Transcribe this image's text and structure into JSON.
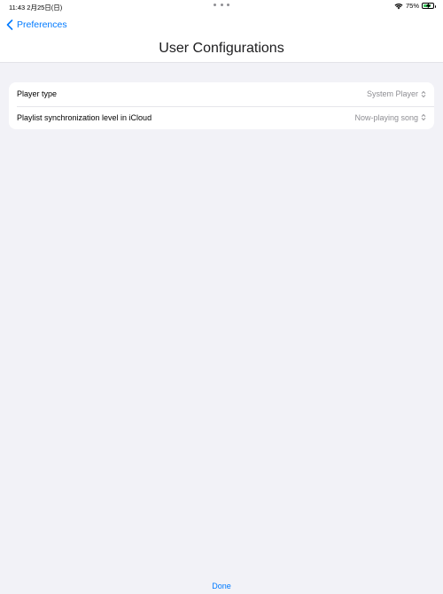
{
  "status_bar": {
    "time_date": "11:43  2月25日(日)",
    "battery_percent": "75%",
    "battery_level": 0.75,
    "wifi_icon": "wifi-icon",
    "battery_icon": "battery-charging-icon"
  },
  "nav": {
    "back_label": "Preferences",
    "back_icon": "chevron-left-icon",
    "title": "User Configurations"
  },
  "settings": {
    "rows": [
      {
        "label": "Player type",
        "value": "System Player",
        "icon": "chevron-up-down-icon"
      },
      {
        "label": "Playlist synchronization level in iCloud",
        "value": "Now-playing song",
        "icon": "chevron-up-down-icon"
      }
    ]
  },
  "toolbar": {
    "done_label": "Done"
  },
  "colors": {
    "accent": "#007aff",
    "background": "#f2f2f7",
    "secondary_text": "#8e8e93",
    "battery_fill": "#34c759"
  }
}
